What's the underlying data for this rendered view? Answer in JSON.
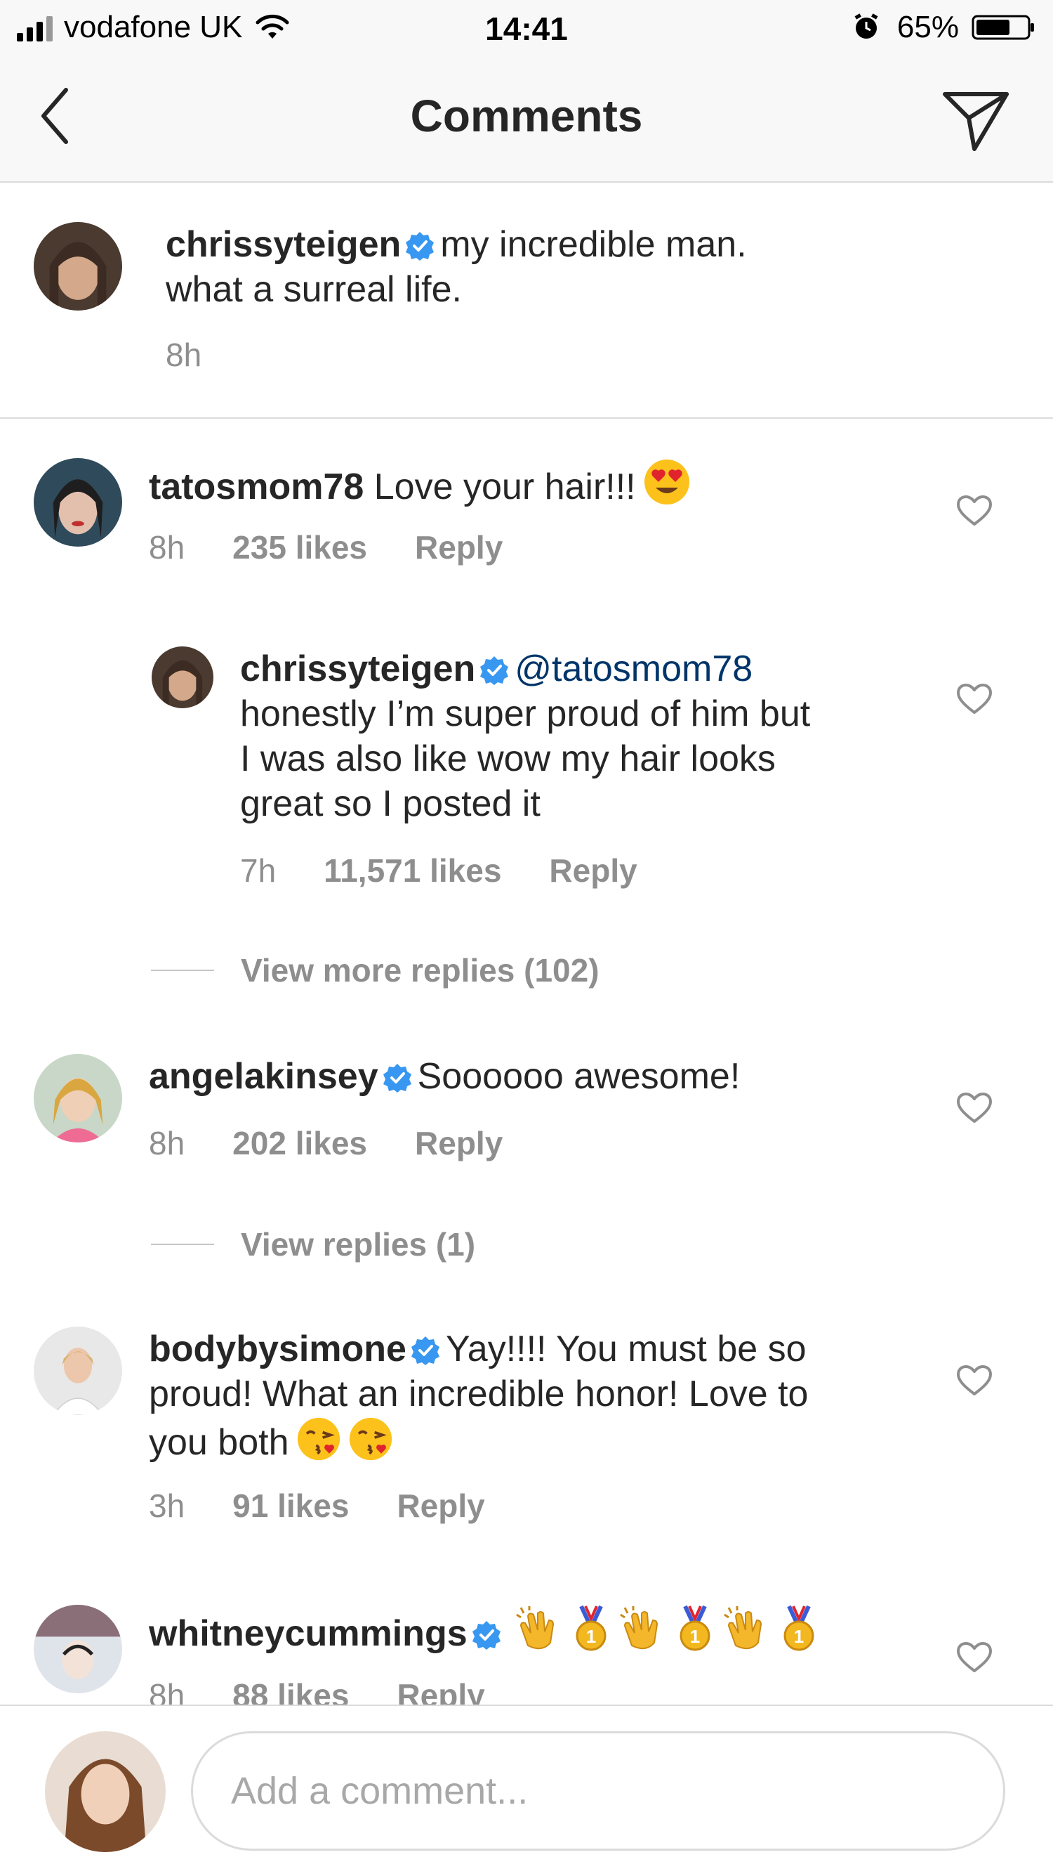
{
  "status_bar": {
    "carrier": "vodafone UK",
    "time": "14:41",
    "battery": "65%"
  },
  "header": {
    "title": "Comments"
  },
  "caption": {
    "username": "chrissyteigen",
    "text": "my incredible man.",
    "text2": "what a surreal life.",
    "time": "8h"
  },
  "comments": [
    {
      "username": "tatosmom78",
      "text": "Love your hair!!!",
      "time": "8h",
      "likes": "235 likes",
      "reply": "Reply"
    },
    {
      "username": "chrissyteigen",
      "mention": "@tatosmom78",
      "line1": "honestly I’m super proud of him but",
      "line2": "I was also like wow my hair looks",
      "line3": "great so I posted it",
      "time": "7h",
      "likes": "11,571 likes",
      "reply": "Reply"
    },
    {
      "username": "angelakinsey",
      "text": "Soooooo awesome!",
      "time": "8h",
      "likes": "202 likes",
      "reply": "Reply"
    },
    {
      "username": "bodybysimone",
      "text": "Yay!!!! You must be so",
      "line2": "proud! What an incredible honor! Love to",
      "line3": "you both",
      "time": "3h",
      "likes": "91 likes",
      "reply": "Reply"
    },
    {
      "username": "whitneycummings",
      "time": "8h",
      "likes": "88 likes",
      "reply": "Reply"
    }
  ],
  "view_more_replies": "View more replies (102)",
  "view_replies": "View replies (1)",
  "composer": {
    "placeholder": "Add a comment..."
  },
  "colors": {
    "verified": "#3897f0",
    "meta": "#8e8e8e",
    "mention": "#003569",
    "border": "#dbdbdb"
  },
  "icons": [
    "signal-icon",
    "wifi-icon",
    "alarm-icon",
    "battery-icon",
    "back-icon",
    "send-icon",
    "verified-icon",
    "heart-icon",
    "heart-eyes-emoji",
    "kiss-emoji",
    "clap-emoji",
    "medal-emoji"
  ]
}
